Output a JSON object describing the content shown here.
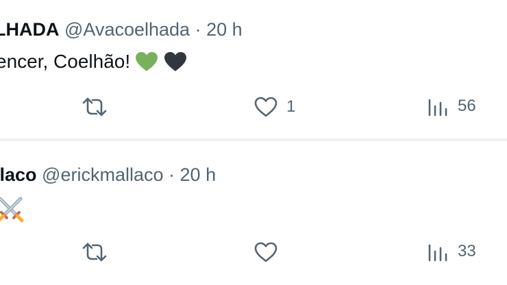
{
  "tweets": [
    {
      "display_name": "LHADA",
      "handle": "@Avacoelhada",
      "separator": "·",
      "time": "20 h",
      "text": "encer, Coelhão!",
      "emojis": [
        "green-heart",
        "black-heart"
      ],
      "actions": {
        "reply_count": "",
        "like_count": "1",
        "view_count": "56"
      }
    },
    {
      "display_name": "llaco",
      "handle": "@erickmallaco",
      "separator": "·",
      "time": "20 h",
      "text": "",
      "emojis": [
        "crossed-swords"
      ],
      "actions": {
        "reply_count": "",
        "like_count": "",
        "view_count": "33"
      }
    }
  ],
  "colors": {
    "text_primary": "#0f1419",
    "text_secondary": "#536471",
    "green_heart": "#78b159",
    "black_heart": "#31373d",
    "divider": "#eff3f4"
  }
}
